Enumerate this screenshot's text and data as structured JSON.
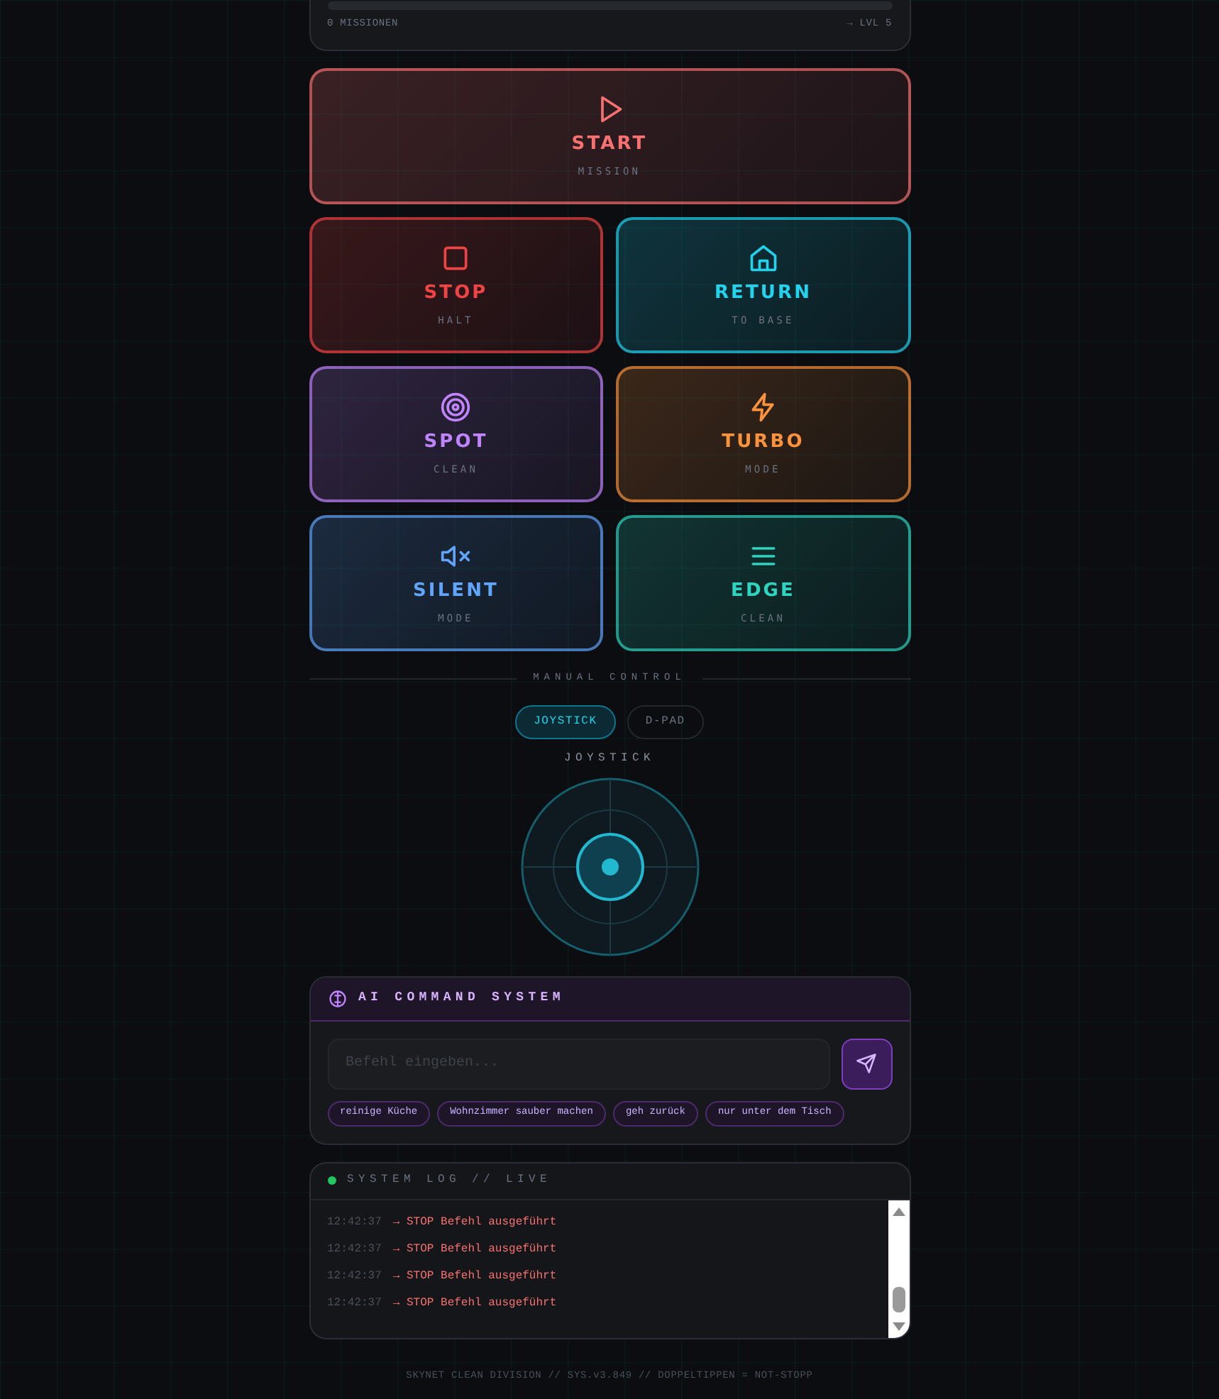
{
  "progress": {
    "level": 0,
    "missions": "0 MISSIONEN",
    "next_level": "→ LVL 5"
  },
  "actions": [
    {
      "kind": "start",
      "label": "START",
      "sub": "MISSION",
      "color": "#f87171"
    },
    {
      "kind": "stop",
      "label": "STOP",
      "sub": "HALT",
      "color": "#ef4444"
    },
    {
      "kind": "return",
      "label": "RETURN",
      "sub": "TO BASE",
      "color": "#22d3ee"
    },
    {
      "kind": "spot",
      "label": "SPOT",
      "sub": "CLEAN",
      "color": "#c084fc"
    },
    {
      "kind": "turbo",
      "label": "TURBO",
      "sub": "MODE",
      "color": "#fb923c"
    },
    {
      "kind": "silent",
      "label": "SILENT",
      "sub": "MODE",
      "color": "#60a5fa"
    },
    {
      "kind": "edge",
      "label": "EDGE",
      "sub": "CLEAN",
      "color": "#2dd4bf"
    }
  ],
  "manual_control": {
    "title": "MANUAL CONTROL",
    "tabs": [
      {
        "label": "JOYSTICK",
        "selected": true
      },
      {
        "label": "D-PAD",
        "selected": false
      }
    ],
    "pad_label": "JOYSTICK"
  },
  "ai": {
    "title": "AI COMMAND SYSTEM",
    "input": {
      "placeholder": "Befehl eingeben..."
    },
    "suggestions": [
      "reinige Küche",
      "Wohnzimmer sauber machen",
      "geh zurück",
      "nur unter dem Tisch"
    ]
  },
  "log": {
    "title": "SYSTEM LOG // LIVE",
    "entries": [
      {
        "time": "12:42:37",
        "message": "→ STOP Befehl ausgeführt"
      },
      {
        "time": "12:42:37",
        "message": "→ STOP Befehl ausgeführt"
      },
      {
        "time": "12:42:37",
        "message": "→ STOP Befehl ausgeführt"
      },
      {
        "time": "12:42:37",
        "message": "→ STOP Befehl ausgeführt"
      }
    ]
  },
  "footer": "SKYNET CLEAN DIVISION // SYS.v3.849 // DOPPELTIPPEN = NOT-STOPP"
}
